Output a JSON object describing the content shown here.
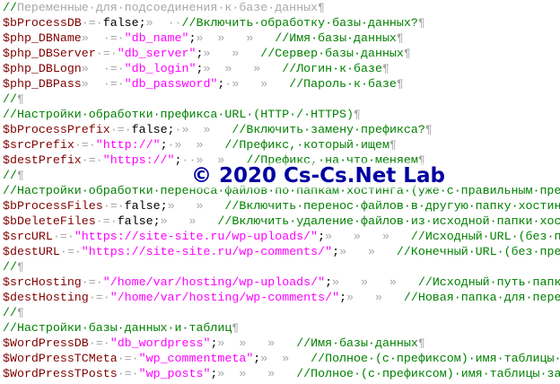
{
  "colors": {
    "comment": "#008000",
    "variable": "#800000",
    "string": "#ff00ff",
    "plain": "#000000",
    "whitespace_marker": "#a8a8a8",
    "watermark": "#0000a0"
  },
  "watermark": "© 2020 Cs-Cs.Net Lab",
  "lines": [
    [
      [
        "c",
        "//"
      ],
      [
        "w",
        "Переменные·для·подсоединения·к·базе·данных"
      ],
      [
        "m",
        "¶"
      ]
    ],
    [
      [
        "v",
        "$bProcessDB"
      ],
      [
        "w",
        "·=·"
      ],
      [
        "p",
        "false;"
      ],
      [
        "w",
        "»  ··"
      ],
      [
        "c",
        "//Включить·обработку·базы·данных?"
      ],
      [
        "m",
        "¶"
      ]
    ],
    [
      [
        "v",
        "$php_DBName"
      ],
      [
        "w",
        "»  ·=·"
      ],
      [
        "s",
        "\"db_name\""
      ],
      [
        "p",
        ";"
      ],
      [
        "w",
        "»  »   »   "
      ],
      [
        "c",
        "//Имя·базы·данных"
      ],
      [
        "m",
        "¶"
      ]
    ],
    [
      [
        "v",
        "$php_DBServer"
      ],
      [
        "w",
        "·=·"
      ],
      [
        "s",
        "\"db_server\""
      ],
      [
        "p",
        ";"
      ],
      [
        "w",
        "»   »   "
      ],
      [
        "c",
        "//Сервер·базы·данных"
      ],
      [
        "m",
        "¶"
      ]
    ],
    [
      [
        "v",
        "$php_DBLogn"
      ],
      [
        "w",
        "»  ·=·"
      ],
      [
        "s",
        "\"db_login\""
      ],
      [
        "p",
        ";"
      ],
      [
        "w",
        "»  »   »   "
      ],
      [
        "c",
        "//Логин·к·базе"
      ],
      [
        "m",
        "¶"
      ]
    ],
    [
      [
        "v",
        "$php_DBPass"
      ],
      [
        "w",
        "»  ·=·"
      ],
      [
        "s",
        "\"db_password\""
      ],
      [
        "p",
        ";"
      ],
      [
        "w",
        "·»   »   "
      ],
      [
        "c",
        "//Пароль·к·базе"
      ],
      [
        "m",
        "¶"
      ]
    ],
    [
      [
        "c",
        "//"
      ],
      [
        "m",
        "¶"
      ]
    ],
    [
      [
        "c",
        "//Настройки·обработки·префикса·URL·(HTTP·/·HTTPS)"
      ],
      [
        "m",
        "¶"
      ]
    ],
    [
      [
        "v",
        "$bProcessPrefix"
      ],
      [
        "w",
        "·=·"
      ],
      [
        "p",
        "false;"
      ],
      [
        "w",
        "·»  »   "
      ],
      [
        "c",
        "//Включить·замену·префикса?"
      ],
      [
        "m",
        "¶"
      ]
    ],
    [
      [
        "v",
        "$srcPrefix"
      ],
      [
        "w",
        "·=·"
      ],
      [
        "s",
        "\"http://\""
      ],
      [
        "p",
        ";"
      ],
      [
        "w",
        "·»  »   "
      ],
      [
        "c",
        "//Префикс,·который·ищем"
      ],
      [
        "m",
        "¶"
      ]
    ],
    [
      [
        "v",
        "$destPrefix"
      ],
      [
        "w",
        "·=·"
      ],
      [
        "s",
        "\"https://\""
      ],
      [
        "p",
        ";"
      ],
      [
        "w",
        "··»  »   "
      ],
      [
        "c",
        "//Префикс,·на·что·меняем"
      ],
      [
        "m",
        "¶"
      ]
    ],
    [
      [
        "c",
        "//"
      ],
      [
        "m",
        "¶"
      ]
    ],
    [
      [
        "c",
        "//Настройки·обработки·переноса·файлов·по·папкам·хостинга·(уже·с·правильным·префиксом)"
      ],
      [
        "m",
        "¶"
      ]
    ],
    [
      [
        "v",
        "$bProcessFiles"
      ],
      [
        "w",
        "·=·"
      ],
      [
        "p",
        "false;"
      ],
      [
        "w",
        "»   »   "
      ],
      [
        "c",
        "//Включить·перенос·файлов·в·другую·папку·хостинга?"
      ],
      [
        "m",
        "¶"
      ]
    ],
    [
      [
        "v",
        "$bDeleteFiles"
      ],
      [
        "w",
        "·=·"
      ],
      [
        "p",
        "false;"
      ],
      [
        "w",
        "»   »   "
      ],
      [
        "c",
        "//Включить·удаление·файлов·из·исходной·папки·хостинга?"
      ],
      [
        "m",
        "¶"
      ]
    ],
    [
      [
        "v",
        "$srcURL"
      ],
      [
        "w",
        "·=·"
      ],
      [
        "s",
        "\"https://site-site.ru/wp-uploads/\""
      ],
      [
        "p",
        ";"
      ],
      [
        "w",
        "»   »   »   "
      ],
      [
        "c",
        "//Исходный·URL·(без·префикса)"
      ],
      [
        "m",
        "¶"
      ]
    ],
    [
      [
        "v",
        "$destURL"
      ],
      [
        "w",
        "·=·"
      ],
      [
        "s",
        "\"https://site-site.ru/wp-comments/\""
      ],
      [
        "p",
        ";"
      ],
      [
        "w",
        "»   »   "
      ],
      [
        "c",
        "//Конечный·URL·(без·префикса)"
      ],
      [
        "m",
        "¶"
      ]
    ],
    [
      [
        "c",
        "//"
      ],
      [
        "m",
        "¶"
      ]
    ],
    [
      [
        "v",
        "$srcHosting"
      ],
      [
        "w",
        "·=·"
      ],
      [
        "s",
        "\"/home/var/hosting/wp-uploads/\""
      ],
      [
        "p",
        ";"
      ],
      [
        "w",
        "»   »   »   "
      ],
      [
        "c",
        "//Исходный·путь·папки·хостинга"
      ],
      [
        "m",
        "¶"
      ]
    ],
    [
      [
        "v",
        "$destHosting"
      ],
      [
        "w",
        "·=·"
      ],
      [
        "s",
        "\"/home/var/hosting/wp-comments/\""
      ],
      [
        "p",
        ";"
      ],
      [
        "w",
        "»   »   "
      ],
      [
        "c",
        "//Новая·папка·для·переноса·файлов"
      ],
      [
        "m",
        "¶"
      ]
    ],
    [
      [
        "c",
        "//"
      ],
      [
        "m",
        "¶"
      ]
    ],
    [
      [
        "c",
        "//Настройки·базы·данных·и·таблиц"
      ],
      [
        "m",
        "¶"
      ]
    ],
    [
      [
        "v",
        "$WordPressDB"
      ],
      [
        "w",
        "·=·"
      ],
      [
        "s",
        "\"db_wordpress\""
      ],
      [
        "p",
        ";"
      ],
      [
        "w",
        "»  »   »   "
      ],
      [
        "c",
        "//Имя·базы·данных"
      ],
      [
        "m",
        "¶"
      ]
    ],
    [
      [
        "v",
        "$WordPressTCMeta"
      ],
      [
        "w",
        "·=·"
      ],
      [
        "s",
        "\"wp_commentmeta\""
      ],
      [
        "p",
        ";"
      ],
      [
        "w",
        "»  »   "
      ],
      [
        "c",
        "//Полное·(с·префиксом)·имя·таблицы·метаданных"
      ],
      [
        "m",
        "¶"
      ]
    ],
    [
      [
        "v",
        "$WordPressTPosts"
      ],
      [
        "w",
        "·=·"
      ],
      [
        "s",
        "\"wp_posts\""
      ],
      [
        "p",
        ";"
      ],
      [
        "w",
        "»  »   »   "
      ],
      [
        "c",
        "//Полное·(с·префиксом)·имя·таблицы·записей"
      ],
      [
        "m",
        "¶"
      ]
    ]
  ]
}
